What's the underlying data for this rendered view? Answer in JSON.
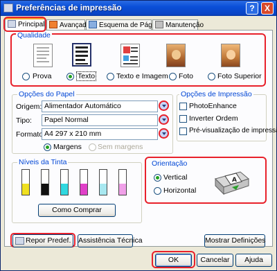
{
  "window": {
    "title": "Preferências de impressão",
    "help_label": "?",
    "close_label": "X"
  },
  "tabs": [
    {
      "label": "Principal",
      "selected": true
    },
    {
      "label": "Avançado"
    },
    {
      "label": "Esquema de Página"
    },
    {
      "label": "Manutenção"
    }
  ],
  "quality": {
    "title": "Qualidade",
    "options": [
      {
        "label": "Prova",
        "selected": false
      },
      {
        "label": "Texto",
        "selected": true
      },
      {
        "label": "Texto e Imagem",
        "selected": false
      },
      {
        "label": "Foto",
        "selected": false
      },
      {
        "label": "Foto Superior",
        "selected": false
      }
    ]
  },
  "paper": {
    "title": "Opções do Papel",
    "origin_label": "Origem:",
    "origin_value": "Alimentador Automático",
    "type_label": "Tipo:",
    "type_value": "Papel Normal",
    "format_label": "Formato:",
    "format_value": "A4 297 x 210 mm",
    "margins_label": "Margens",
    "no_margins_label": "Sem margens"
  },
  "print_options": {
    "title": "Opções de Impressão",
    "items": [
      {
        "label": "PhotoEnhance",
        "checked": false
      },
      {
        "label": "Inverter Ordem",
        "checked": false
      },
      {
        "label": "Pré-visualização de impressão",
        "checked": false
      }
    ]
  },
  "ink": {
    "title": "Níveis da Tinta",
    "buy_button": "Como Comprar",
    "cartridges": [
      {
        "color": "#f0e020",
        "level": 0.45
      },
      {
        "color": "#101010",
        "level": 0.45
      },
      {
        "color": "#30d8e0",
        "level": 0.45
      },
      {
        "color": "#e040c8",
        "level": 0.45
      },
      {
        "color": "#a8e8f0",
        "level": 0.45
      },
      {
        "color": "#f0a0e8",
        "level": 0.45
      }
    ]
  },
  "orientation": {
    "title": "Orientação",
    "vertical_label": "Vertical",
    "horizontal_label": "Horizontal",
    "selected": "vertical"
  },
  "bottom": {
    "reset_label": "Repor Predef.",
    "tech_support_label": "Assistência Técnica",
    "show_settings_label": "Mostrar Definições"
  },
  "dialog": {
    "ok_label": "OK",
    "cancel_label": "Cancelar",
    "help_label": "Ajuda"
  },
  "colors": {
    "highlight": "#e8202a",
    "group_title": "#0046d5",
    "titlebar": "#0a4fd8"
  }
}
